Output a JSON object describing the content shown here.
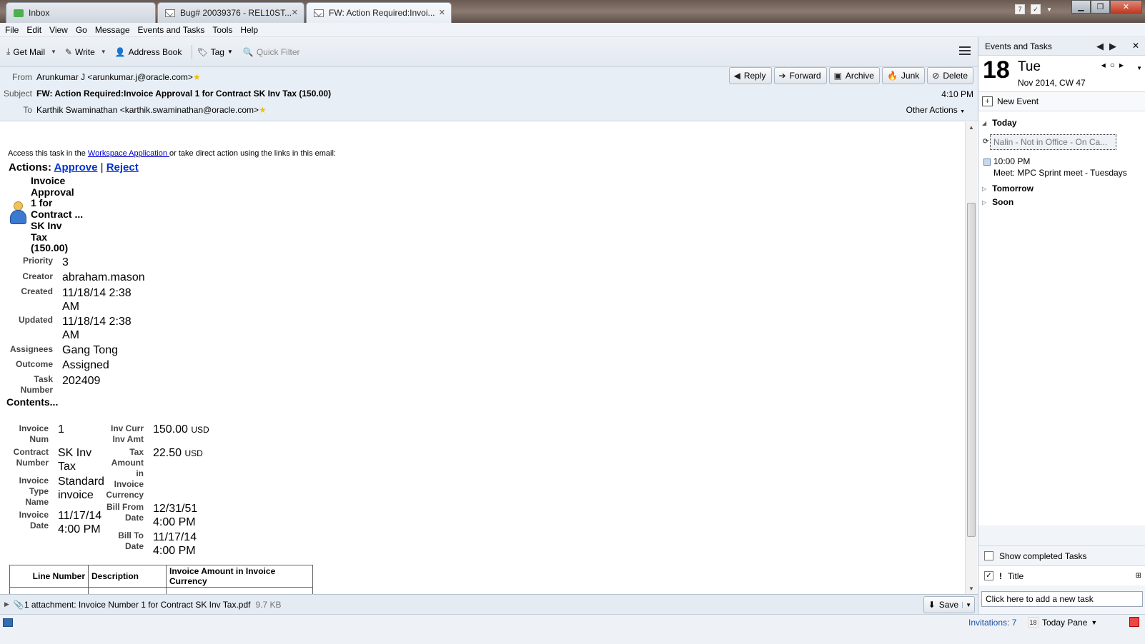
{
  "tabs": [
    {
      "label": "Inbox",
      "icon": "inbox-icon"
    },
    {
      "label": "Bug# 20039376 - REL10ST...",
      "icon": "envelope-icon",
      "closable": true
    },
    {
      "label": "FW: Action Required:Invoi...",
      "icon": "envelope-icon",
      "closable": true,
      "active": true
    }
  ],
  "menu": [
    "File",
    "Edit",
    "View",
    "Go",
    "Message",
    "Events and Tasks",
    "Tools",
    "Help"
  ],
  "toolbar": {
    "get_mail": "Get Mail",
    "write": "Write",
    "address_book": "Address Book",
    "tag": "Tag",
    "quick_filter": "Quick Filter"
  },
  "header": {
    "from_label": "From",
    "from": "Arunkumar J <arunkumar.j@oracle.com>",
    "subject_label": "Subject",
    "subject": "FW: Action Required:Invoice Approval 1 for Contract SK Inv Tax (150.00)",
    "to_label": "To",
    "to": "Karthik Swaminathan <karthik.swaminathan@oracle.com>",
    "time": "4:10 PM",
    "other_actions": "Other Actions",
    "buttons": {
      "reply": "Reply",
      "forward": "Forward",
      "archive": "Archive",
      "junk": "Junk",
      "delete": "Delete"
    }
  },
  "message": {
    "access_pre": "Access this task in the ",
    "access_link": "Workspace Application ",
    "access_post": "or take direct action using the links in this email:",
    "actions_label": "Actions:",
    "approve": "Approve",
    "sep": "|",
    "reject": "Reject",
    "task_title_lines": [
      "Invoice",
      "Approval",
      "1 for",
      "Contract ...",
      "SK Inv",
      "Tax",
      "(150.00)"
    ],
    "attributes": [
      {
        "label": "Priority",
        "value": "3"
      },
      {
        "label": "Creator",
        "value": "abraham.mason"
      },
      {
        "label": "Created",
        "value": "11/18/14 2:38 AM"
      },
      {
        "label": "Updated",
        "value": "11/18/14 2:38 AM"
      },
      {
        "label": "Assignees",
        "value": "Gang Tong"
      },
      {
        "label": "Outcome",
        "value": "Assigned"
      },
      {
        "label": "Task Number",
        "value": "202409"
      }
    ],
    "contents_label": "Contents...",
    "contents_left": [
      {
        "label": "Invoice Num",
        "value": "1"
      },
      {
        "label": "Contract Number",
        "value": "SK Inv Tax"
      },
      {
        "label": "Invoice Type Name",
        "value": "Standard invoice"
      },
      {
        "label": "Invoice Date",
        "value": "11/17/14 4:00 PM"
      }
    ],
    "contents_right": [
      {
        "label": "Inv Curr Inv Amt",
        "value": "150.00",
        "currency": "USD"
      },
      {
        "label": "Tax Amount in Invoice Currency",
        "value": "22.50",
        "currency": "USD"
      },
      {
        "label": "Bill From Date",
        "value": "12/31/51 4:00 PM"
      },
      {
        "label": "Bill To Date",
        "value": "11/17/14 4:00 PM"
      }
    ],
    "lines_table": {
      "headers": [
        "Line Number",
        "Description",
        "Invoice Amount in Invoice Currency"
      ]
    }
  },
  "attachment": {
    "text": "1 attachment: Invoice Number 1 for Contract SK Inv Tax.pdf",
    "size": "9.7 KB",
    "save": "Save"
  },
  "right_pane": {
    "title": "Events and Tasks",
    "day_num": "18",
    "day_name": "Tue",
    "month_week": "Nov 2014, CW 47",
    "new_event": "New Event",
    "today": "Today",
    "selected_event": "Nalin - Not in Office - On Ca...",
    "event_time": "10:00 PM",
    "event_title": "Meet: MPC Sprint meet - Tuesdays",
    "tomorrow": "Tomorrow",
    "soon": "Soon",
    "show_completed": "Show completed Tasks",
    "title_col": "Title",
    "new_task_placeholder": "Click here to add a new task"
  },
  "status": {
    "invitations": "Invitations: 7",
    "today_pane": "Today Pane",
    "today_pane_day": "18"
  }
}
